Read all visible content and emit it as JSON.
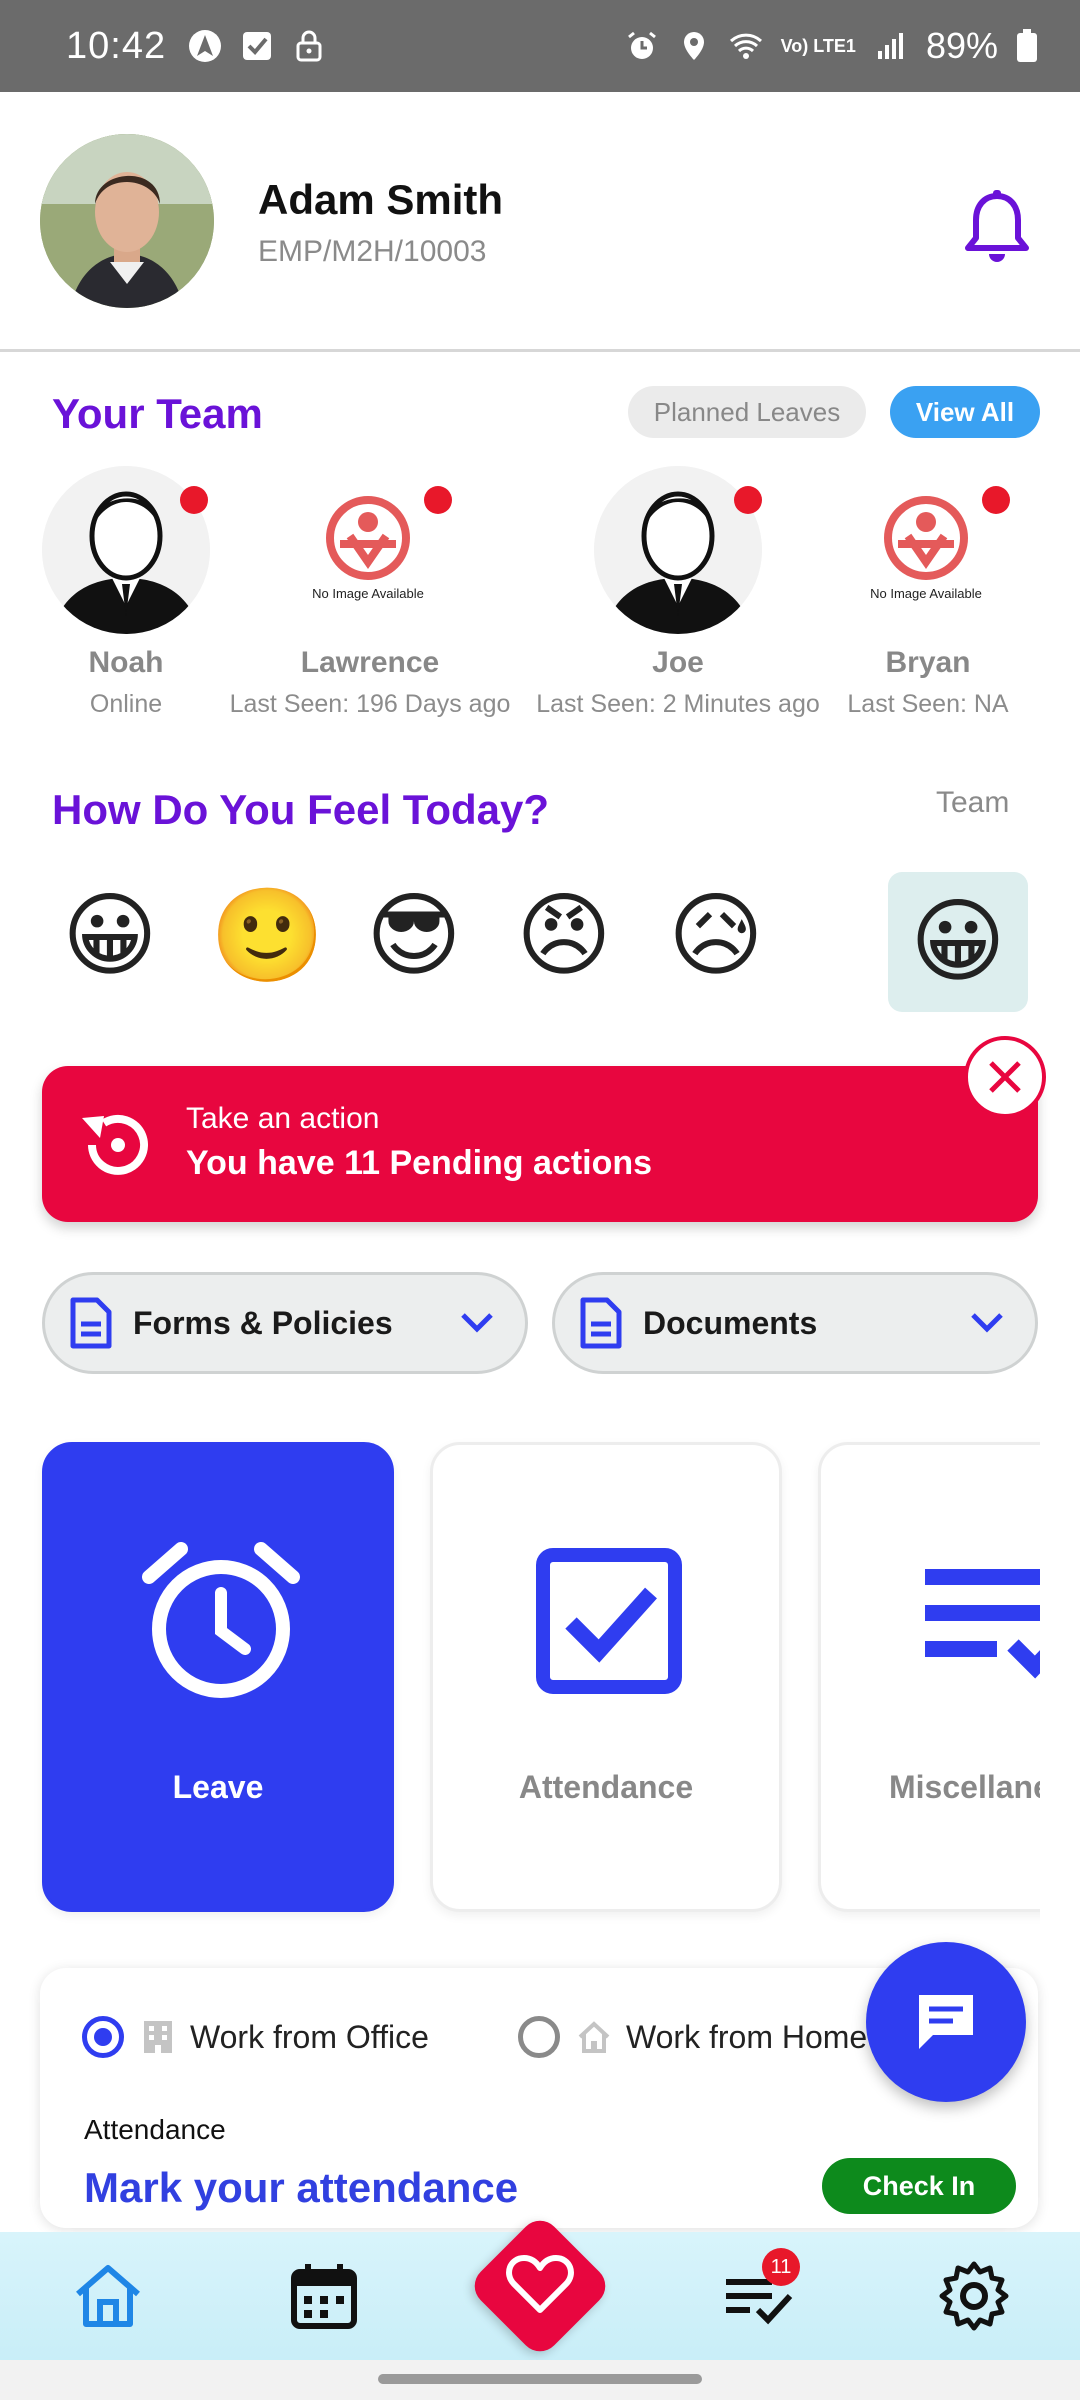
{
  "status_bar": {
    "time": "10:42",
    "battery": "89%",
    "network": "Vo) LTE1"
  },
  "profile": {
    "name": "Adam  Smith",
    "employee_id": "EMP/M2H/10003"
  },
  "team": {
    "title": "Your Team",
    "planned_leaves_label": "Planned Leaves",
    "view_all_label": "View All",
    "no_image_text": "No Image Available",
    "members": [
      {
        "name": "Noah",
        "status": "Online"
      },
      {
        "name": "Lawrence",
        "status": "Last Seen: 196 Days ago"
      },
      {
        "name": "Joe",
        "status": "Last Seen: 2 Minutes ago"
      },
      {
        "name": "Bryan",
        "status": "Last Seen: NA"
      }
    ]
  },
  "feelings": {
    "title": "How Do You Feel Today?",
    "team_label": "Team",
    "emojis": [
      "😀",
      "🙂",
      "😎",
      "😠",
      "😥"
    ],
    "team_emoji": "😀"
  },
  "pending": {
    "subtitle": "Take an action",
    "message": "You have 11 Pending actions"
  },
  "dropdowns": {
    "forms_label": "Forms & Policies",
    "documents_label": "Documents"
  },
  "tiles": {
    "leave": "Leave",
    "attendance": "Attendance",
    "misc": "Miscellaneous"
  },
  "attendance": {
    "office_option": "Work from Office",
    "home_option": "Work from Home",
    "label": "Attendance",
    "title": "Mark your attendance",
    "checkin_label": "Check In"
  },
  "bottom_nav": {
    "tasks_badge": "11"
  },
  "colors": {
    "accent_purple": "#6a12d8",
    "primary_blue": "#2f3df0",
    "alert_red": "#e8063f",
    "checkin_green": "#0d8a1c"
  }
}
